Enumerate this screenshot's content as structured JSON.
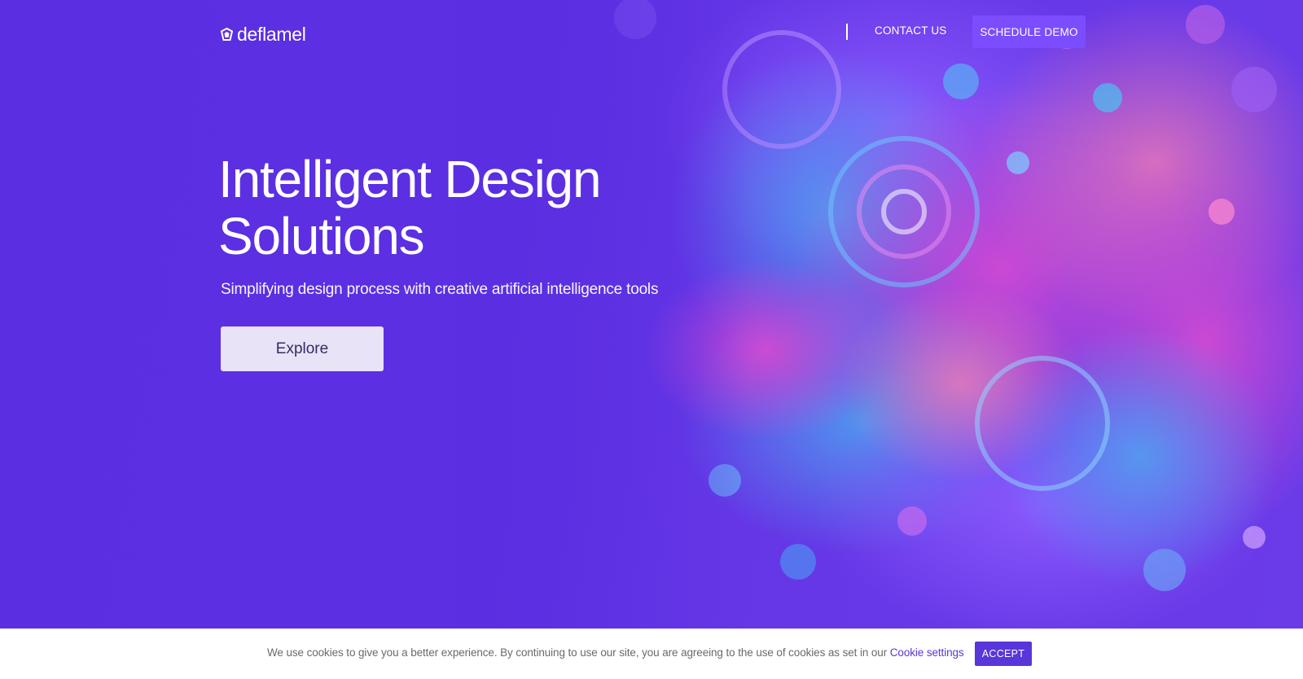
{
  "nav": {
    "logo_text": "deflamel",
    "contact_label": "CONTACT US",
    "demo_label": "SCHEDULE DEMO"
  },
  "hero": {
    "title_line1": "Intelligent Design",
    "title_line2": "Solutions",
    "subtitle": "Simplifying design process with creative artificial intelligence tools",
    "cta_label": "Explore"
  },
  "cookie": {
    "message": "We use cookies to give you a better experience. By continuing to use our site, you are agreeing to the use of cookies as set in our",
    "link_label": "Cookie settings",
    "accept_label": "ACCEPT"
  },
  "colors": {
    "hero_bg": "#5b2fe1",
    "demo_button": "#7c4dff",
    "explore_button": "#e8e3f7",
    "accept_button": "#5936d9",
    "link": "#5a35d6"
  },
  "icons": {
    "logo": "deflamel-logo-icon"
  }
}
